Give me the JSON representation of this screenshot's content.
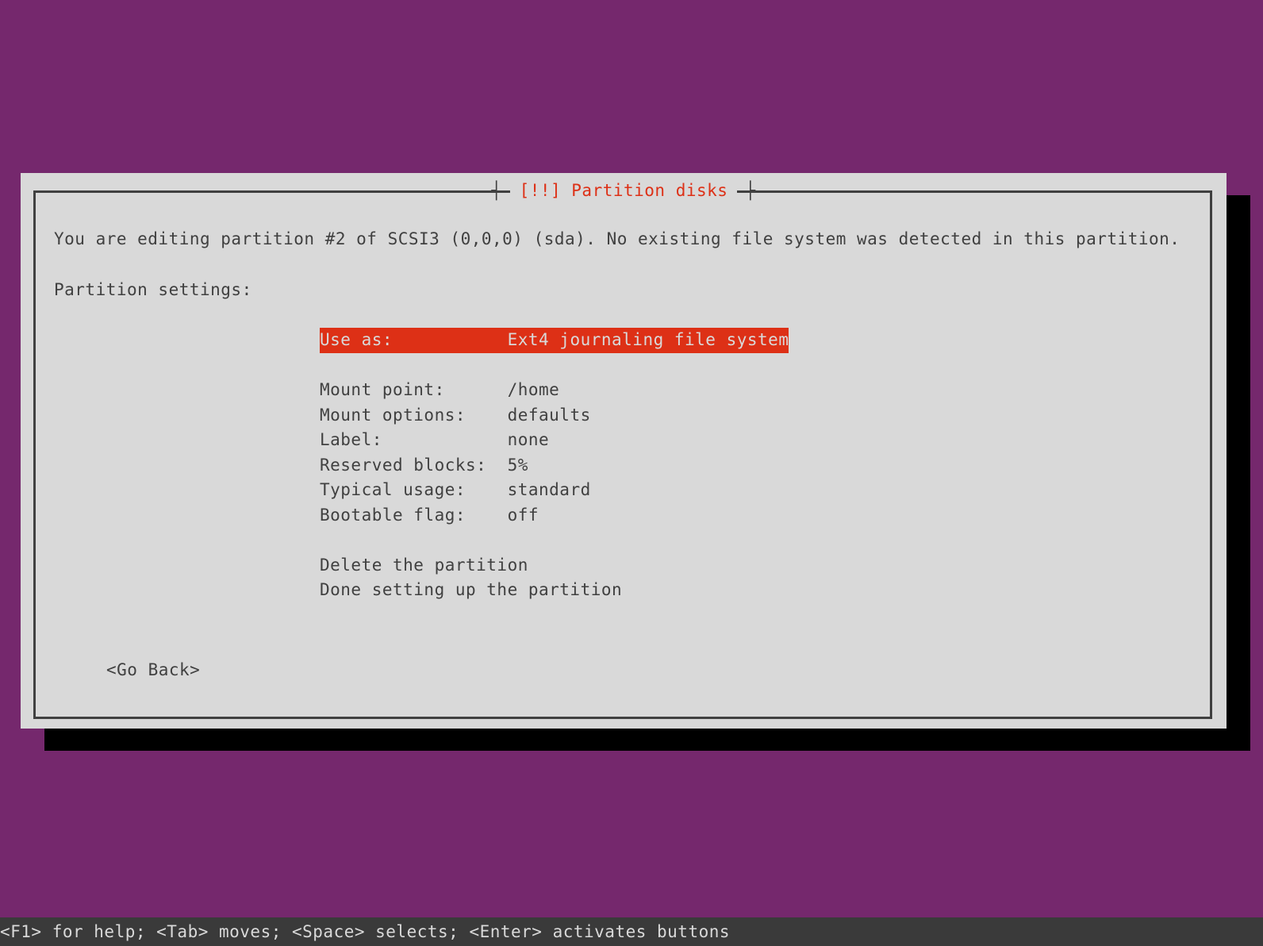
{
  "dialog": {
    "title": "[!!] Partition disks",
    "description": "You are editing partition #2 of SCSI3 (0,0,0) (sda). No existing file system was detected in this partition.",
    "subtitle": "Partition settings:",
    "settings": {
      "use_as": {
        "label": "Use as:",
        "value": "Ext4 journaling file system"
      },
      "mount_point": {
        "label": "Mount point:",
        "value": "/home"
      },
      "mount_options": {
        "label": "Mount options:",
        "value": "defaults"
      },
      "label": {
        "label": "Label:",
        "value": "none"
      },
      "reserved_blocks": {
        "label": "Reserved blocks:",
        "value": "5%"
      },
      "typical_usage": {
        "label": "Typical usage:",
        "value": "standard"
      },
      "bootable_flag": {
        "label": "Bootable flag:",
        "value": "off"
      }
    },
    "actions": {
      "delete": "Delete the partition",
      "done": "Done setting up the partition"
    },
    "go_back": "<Go Back>"
  },
  "footer": "<F1> for help; <Tab> moves; <Space> selects; <Enter> activates buttons"
}
